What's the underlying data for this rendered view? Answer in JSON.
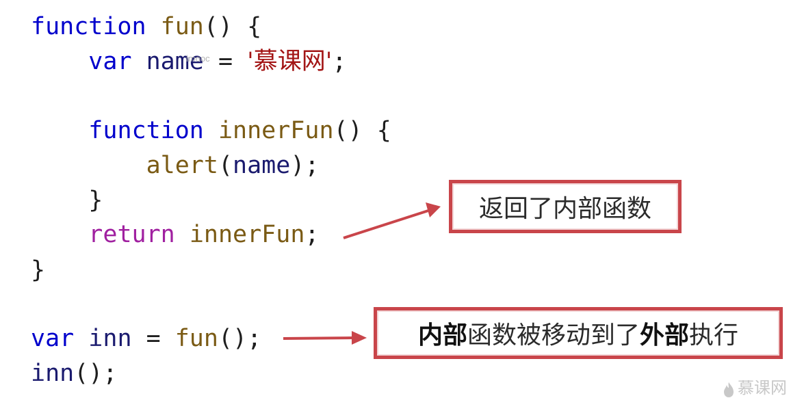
{
  "code": {
    "line1": {
      "kw": "function",
      "fn": "fun",
      "rest": "() {"
    },
    "line2": {
      "indent": "    ",
      "kw": "var",
      "id": "name",
      "eq": " = ",
      "str": "'慕课网'",
      "end": ";"
    },
    "line4": {
      "indent": "    ",
      "kw": "function",
      "fn": "innerFun",
      "rest": "() {"
    },
    "line5": {
      "indent": "        ",
      "fn": "alert",
      "open": "(",
      "id": "name",
      "close": ");"
    },
    "line6": {
      "indent": "    ",
      "brace": "}"
    },
    "line7": {
      "indent": "    ",
      "kw": "return",
      "fn": "innerFun",
      "end": ";"
    },
    "line8": {
      "brace": "}"
    },
    "line10": {
      "kw": "var",
      "id": "inn",
      "eq": " = ",
      "fn": "fun",
      "rest": "();"
    },
    "line11": {
      "id": "inn",
      "rest": "();"
    }
  },
  "watermark_small": "imooc",
  "callouts": {
    "first": "返回了内部函数",
    "second_parts": {
      "a_bold": "内部",
      "b": "函数被移动到了",
      "c_bold": "外部",
      "d": "执行"
    }
  },
  "logo": {
    "text": "慕课网",
    "icon": "flame-icon"
  },
  "colors": {
    "keyword": "#0000cc",
    "return_keyword": "#a020a0",
    "function_name": "#7a5a14",
    "identifier": "#1a1a6e",
    "string": "#a31515",
    "callout_border": "#c9454a",
    "arrow": "#c9454a"
  }
}
